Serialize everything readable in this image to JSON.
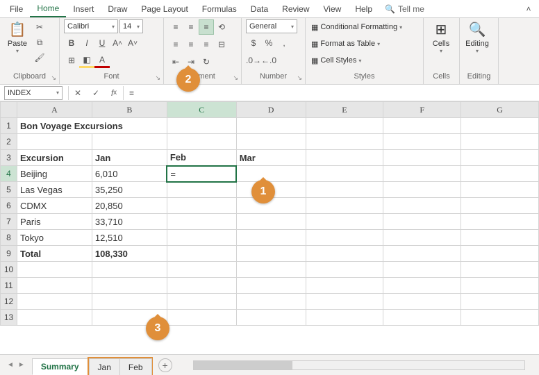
{
  "menu": {
    "items": [
      "File",
      "Home",
      "Insert",
      "Draw",
      "Page Layout",
      "Formulas",
      "Data",
      "Review",
      "View",
      "Help"
    ],
    "active": "Home",
    "tellme": "Tell me"
  },
  "ribbon": {
    "clipboard": {
      "label": "Clipboard",
      "paste": "Paste"
    },
    "font": {
      "label": "Font",
      "name": "Calibri",
      "size": "14"
    },
    "alignment": {
      "label": "gnment"
    },
    "number": {
      "label": "Number",
      "format": "General"
    },
    "styles": {
      "label": "Styles",
      "cond": "Conditional Formatting",
      "table": "Format as Table",
      "cell": "Cell Styles"
    },
    "cells": {
      "label": "Cells",
      "btn": "Cells"
    },
    "editing": {
      "label": "Editing",
      "btn": "Editing"
    }
  },
  "namebox": "INDEX",
  "formula": "=",
  "columns": [
    "A",
    "B",
    "C",
    "D",
    "E",
    "F",
    "G"
  ],
  "rows_visible": 13,
  "active_cell": {
    "row": 4,
    "col": "C",
    "value": "="
  },
  "sheet": {
    "title": "Bon Voyage Excursions",
    "headers": {
      "A": "Excursion",
      "B": "Jan",
      "C": "Feb",
      "D": "Mar"
    },
    "data": [
      {
        "name": "Beijing",
        "jan": "6,010"
      },
      {
        "name": "Las Vegas",
        "jan": "35,250"
      },
      {
        "name": "CDMX",
        "jan": "20,850"
      },
      {
        "name": "Paris",
        "jan": "33,710"
      },
      {
        "name": "Tokyo",
        "jan": "12,510"
      }
    ],
    "total": {
      "label": "Total",
      "jan": "108,330"
    }
  },
  "tabs": {
    "active": "Summary",
    "grouped": [
      "Jan",
      "Feb"
    ]
  },
  "callouts": {
    "c1": "1",
    "c2": "2",
    "c3": "3"
  }
}
